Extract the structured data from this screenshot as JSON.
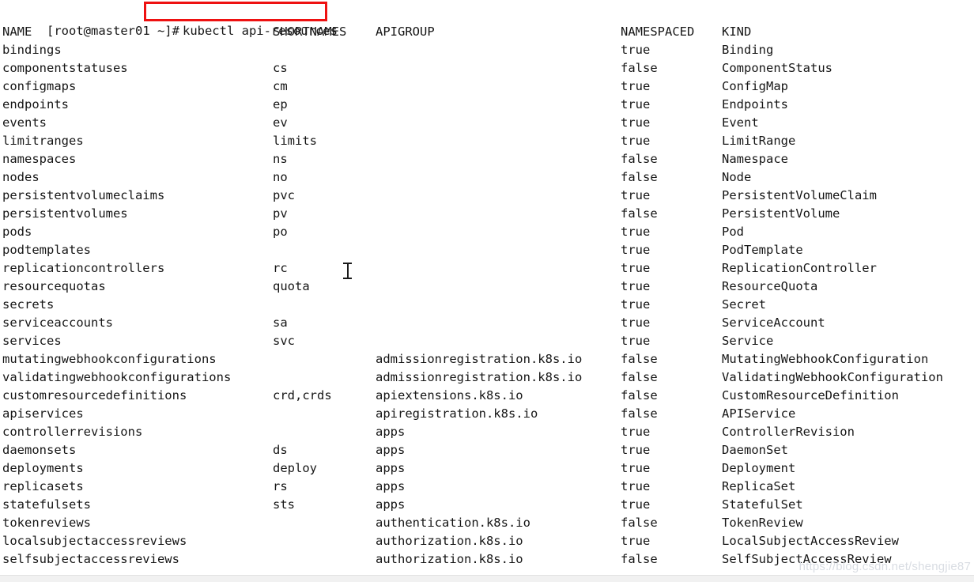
{
  "terminal": {
    "prompt": "[root@master01 ~]#",
    "command": "kubectl api-resources",
    "highlight_color": "#ee1111",
    "text_color": "#161616",
    "background_color": "#ffffff"
  },
  "table": {
    "headers": {
      "name": "NAME",
      "shortnames": "SHORTNAMES",
      "apigroup": "APIGROUP",
      "namespaced": "NAMESPACED",
      "kind": "KIND"
    },
    "rows": [
      {
        "name": "bindings",
        "shortnames": "",
        "apigroup": "",
        "namespaced": "true",
        "kind": "Binding"
      },
      {
        "name": "componentstatuses",
        "shortnames": "cs",
        "apigroup": "",
        "namespaced": "false",
        "kind": "ComponentStatus"
      },
      {
        "name": "configmaps",
        "shortnames": "cm",
        "apigroup": "",
        "namespaced": "true",
        "kind": "ConfigMap"
      },
      {
        "name": "endpoints",
        "shortnames": "ep",
        "apigroup": "",
        "namespaced": "true",
        "kind": "Endpoints"
      },
      {
        "name": "events",
        "shortnames": "ev",
        "apigroup": "",
        "namespaced": "true",
        "kind": "Event"
      },
      {
        "name": "limitranges",
        "shortnames": "limits",
        "apigroup": "",
        "namespaced": "true",
        "kind": "LimitRange"
      },
      {
        "name": "namespaces",
        "shortnames": "ns",
        "apigroup": "",
        "namespaced": "false",
        "kind": "Namespace"
      },
      {
        "name": "nodes",
        "shortnames": "no",
        "apigroup": "",
        "namespaced": "false",
        "kind": "Node"
      },
      {
        "name": "persistentvolumeclaims",
        "shortnames": "pvc",
        "apigroup": "",
        "namespaced": "true",
        "kind": "PersistentVolumeClaim"
      },
      {
        "name": "persistentvolumes",
        "shortnames": "pv",
        "apigroup": "",
        "namespaced": "false",
        "kind": "PersistentVolume"
      },
      {
        "name": "pods",
        "shortnames": "po",
        "apigroup": "",
        "namespaced": "true",
        "kind": "Pod"
      },
      {
        "name": "podtemplates",
        "shortnames": "",
        "apigroup": "",
        "namespaced": "true",
        "kind": "PodTemplate"
      },
      {
        "name": "replicationcontrollers",
        "shortnames": "rc",
        "apigroup": "",
        "namespaced": "true",
        "kind": "ReplicationController"
      },
      {
        "name": "resourcequotas",
        "shortnames": "quota",
        "apigroup": "",
        "namespaced": "true",
        "kind": "ResourceQuota"
      },
      {
        "name": "secrets",
        "shortnames": "",
        "apigroup": "",
        "namespaced": "true",
        "kind": "Secret"
      },
      {
        "name": "serviceaccounts",
        "shortnames": "sa",
        "apigroup": "",
        "namespaced": "true",
        "kind": "ServiceAccount"
      },
      {
        "name": "services",
        "shortnames": "svc",
        "apigroup": "",
        "namespaced": "true",
        "kind": "Service"
      },
      {
        "name": "mutatingwebhookconfigurations",
        "shortnames": "",
        "apigroup": "admissionregistration.k8s.io",
        "namespaced": "false",
        "kind": "MutatingWebhookConfiguration"
      },
      {
        "name": "validatingwebhookconfigurations",
        "shortnames": "",
        "apigroup": "admissionregistration.k8s.io",
        "namespaced": "false",
        "kind": "ValidatingWebhookConfiguration"
      },
      {
        "name": "customresourcedefinitions",
        "shortnames": "crd,crds",
        "apigroup": "apiextensions.k8s.io",
        "namespaced": "false",
        "kind": "CustomResourceDefinition"
      },
      {
        "name": "apiservices",
        "shortnames": "",
        "apigroup": "apiregistration.k8s.io",
        "namespaced": "false",
        "kind": "APIService"
      },
      {
        "name": "controllerrevisions",
        "shortnames": "",
        "apigroup": "apps",
        "namespaced": "true",
        "kind": "ControllerRevision"
      },
      {
        "name": "daemonsets",
        "shortnames": "ds",
        "apigroup": "apps",
        "namespaced": "true",
        "kind": "DaemonSet"
      },
      {
        "name": "deployments",
        "shortnames": "deploy",
        "apigroup": "apps",
        "namespaced": "true",
        "kind": "Deployment"
      },
      {
        "name": "replicasets",
        "shortnames": "rs",
        "apigroup": "apps",
        "namespaced": "true",
        "kind": "ReplicaSet"
      },
      {
        "name": "statefulsets",
        "shortnames": "sts",
        "apigroup": "apps",
        "namespaced": "true",
        "kind": "StatefulSet"
      },
      {
        "name": "tokenreviews",
        "shortnames": "",
        "apigroup": "authentication.k8s.io",
        "namespaced": "false",
        "kind": "TokenReview"
      },
      {
        "name": "localsubjectaccessreviews",
        "shortnames": "",
        "apigroup": "authorization.k8s.io",
        "namespaced": "true",
        "kind": "LocalSubjectAccessReview"
      },
      {
        "name": "selfsubjectaccessreviews",
        "shortnames": "",
        "apigroup": "authorization.k8s.io",
        "namespaced": "false",
        "kind": "SelfSubjectAccessReview"
      }
    ]
  },
  "watermark": {
    "text": "https://blog.csdn.net/shengjie87"
  }
}
